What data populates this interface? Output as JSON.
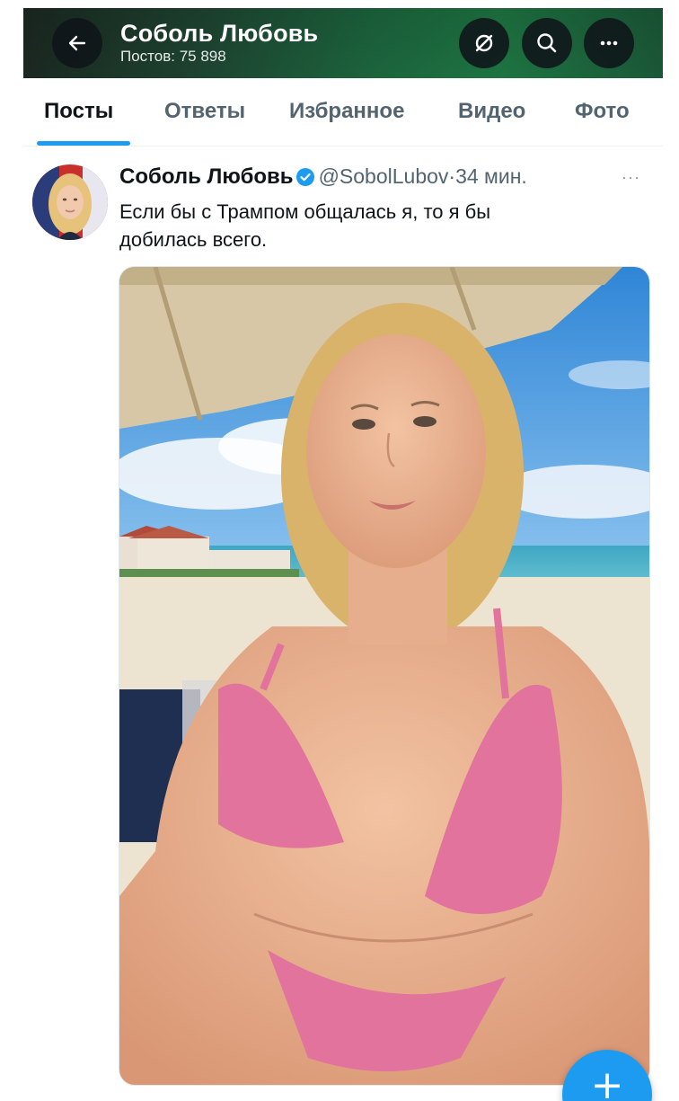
{
  "header": {
    "name": "Соболь Любовь",
    "posts_count": "Постов: 75 898",
    "icons": [
      "back-arrow-icon",
      "grok-icon",
      "search-icon",
      "more-icon"
    ]
  },
  "tabs": [
    {
      "label": "Посты",
      "active": true
    },
    {
      "label": "Ответы",
      "active": false
    },
    {
      "label": "Избранное",
      "active": false
    },
    {
      "label": "Видео",
      "active": false
    },
    {
      "label": "Фото",
      "active": false
    }
  ],
  "post": {
    "author": "Соболь Любовь",
    "verified": true,
    "handle": "@SobolLubov",
    "separator": "·",
    "time": "34 мин.",
    "text": "Если бы с Трампом общалась я, то я бы добилась всего.",
    "more_icon": "···"
  },
  "fab": {
    "label": "+"
  },
  "colors": {
    "accent": "#1d9bf0",
    "header_green": "#1f7a45",
    "text_primary": "#0f1419",
    "text_secondary": "#536471"
  }
}
